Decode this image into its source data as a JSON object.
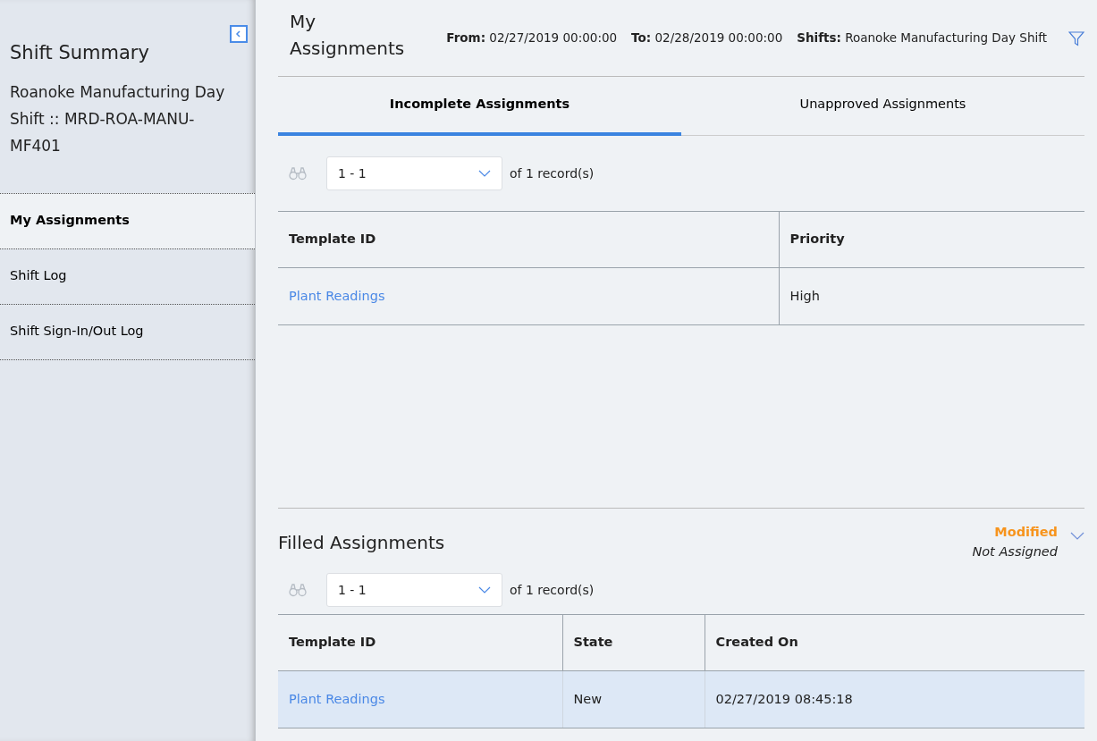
{
  "sidebar": {
    "title": "Shift Summary",
    "subtitle_lines": [
      "Roanoke Manufacturing Day",
      "Shift :: MRD-ROA-MANU-MF401"
    ],
    "items": [
      {
        "label": "My Assignments",
        "selected": true
      },
      {
        "label": "Shift Log",
        "selected": false
      },
      {
        "label": "Shift Sign-In/Out Log",
        "selected": false
      }
    ]
  },
  "header": {
    "title": "My Assignments",
    "filters": [
      {
        "label": "From:",
        "value": "02/27/2019 00:00:00"
      },
      {
        "label": "To:",
        "value": "02/28/2019 00:00:00"
      },
      {
        "label": "Shifts:",
        "value": "Roanoke Manufacturing Day Shift"
      }
    ]
  },
  "tabs": [
    {
      "label": "Incomplete Assignments",
      "selected": true
    },
    {
      "label": "Unapproved Assignments",
      "selected": false
    }
  ],
  "incomplete": {
    "pager": {
      "range": "1 - 1",
      "of": "of",
      "count": "1",
      "unit": "record(s)"
    },
    "columns": [
      "Template ID",
      "Priority"
    ],
    "rows": [
      {
        "selected": false,
        "cells": [
          "Plant Readings",
          "High"
        ]
      }
    ]
  },
  "filled": {
    "title": "Filled Assignments",
    "status": "Modified",
    "assignee": "Not Assigned",
    "pager": {
      "range": "1 - 1",
      "of": "of",
      "count": "1",
      "unit": "record(s)"
    },
    "columns": [
      "Template ID",
      "State",
      "Created On"
    ],
    "rows": [
      {
        "selected": true,
        "cells": [
          "Plant Readings",
          "New",
          "02/27/2019 08:45:18"
        ]
      }
    ]
  }
}
